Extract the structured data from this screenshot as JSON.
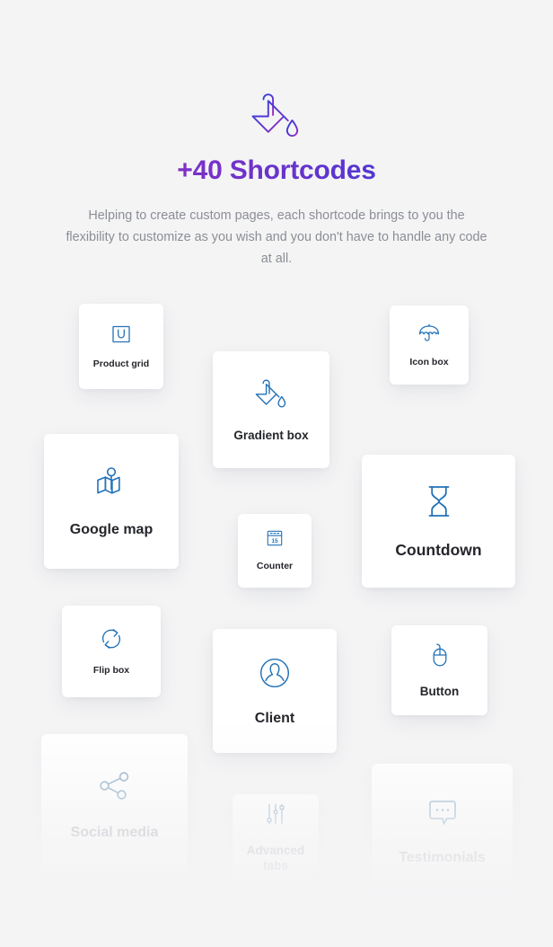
{
  "header": {
    "hero_icon": "paint-bucket-icon",
    "title": "+40 Shortcodes",
    "description": "Helping to create custom pages, each shortcode brings to you the flexibility to customize as you wish and you don't have to handle any code at all."
  },
  "colors": {
    "background": "#f4f4f5",
    "card_background": "#ffffff",
    "icon_blue": "#2272b8",
    "label_dark": "#25262b",
    "body_text": "#8b8e95",
    "title_gradient_start": "#a32bc0",
    "title_gradient_end": "#2d43db",
    "hero_icon_gradient_start": "#2d43db",
    "hero_icon_gradient_end": "#a32bc0",
    "muted_icon": "#7ea2c4",
    "muted_label": "#9ba0a8"
  },
  "cards": [
    {
      "label": "Product grid",
      "icon": "shopping-bag-icon"
    },
    {
      "label": "Icon box",
      "icon": "umbrella-icon"
    },
    {
      "label": "Gradient box",
      "icon": "paint-bucket-icon"
    },
    {
      "label": "Google map",
      "icon": "map-pin-icon"
    },
    {
      "label": "Countdown",
      "icon": "hourglass-icon"
    },
    {
      "label": "Counter",
      "icon": "calendar-15-icon"
    },
    {
      "label": "Flip box",
      "icon": "refresh-arrows-icon"
    },
    {
      "label": "Client",
      "icon": "person-circle-icon"
    },
    {
      "label": "Button",
      "icon": "computer-mouse-icon"
    },
    {
      "label": "Social media",
      "icon": "share-nodes-icon"
    },
    {
      "label": "Advanced tabs",
      "icon": "sliders-icon"
    },
    {
      "label": "Testimonials",
      "icon": "speech-bubble-icon"
    }
  ],
  "counter_icon_value": "15"
}
